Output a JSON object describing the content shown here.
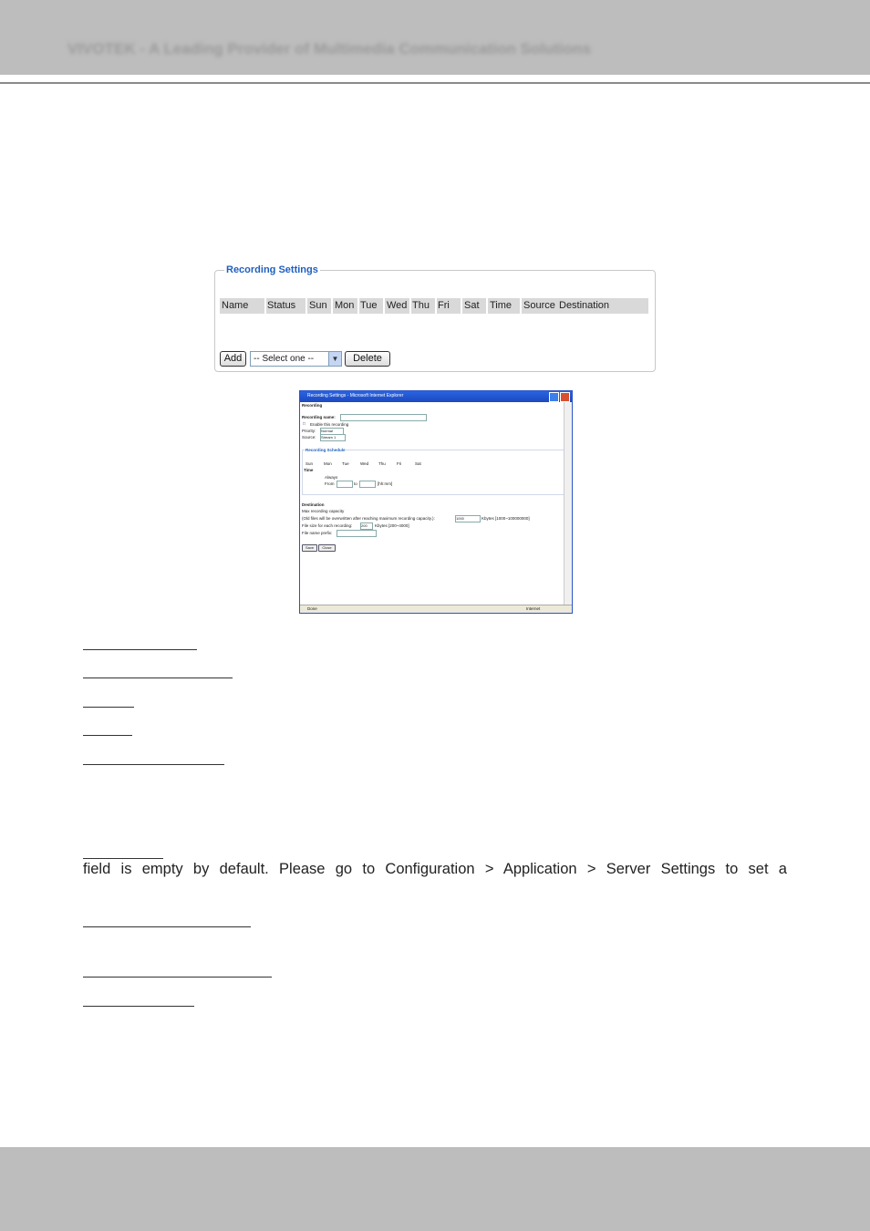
{
  "header": {
    "title": "VIVOTEK - A Leading Provider of Multimedia Communication Solutions"
  },
  "recording_settings": {
    "legend": "Recording Settings",
    "columns": [
      "Name",
      "Status",
      "Sun",
      "Mon",
      "Tue",
      "Wed",
      "Thu",
      "Fri",
      "Sat",
      "Time",
      "Source",
      "Destination"
    ],
    "add_label": "Add",
    "select_value": "-- Select one --",
    "delete_label": "Delete"
  },
  "dialog_screenshot": {
    "window_title": "Recording Settings - Microsoft Internet Explorer",
    "tab": "Recording",
    "recording_name_label": "Recording name:",
    "enable_label": "Enable this recording",
    "priority_label": "Priority:",
    "priority_value": "Normal",
    "source_label": "Source:",
    "source_value": "Stream 1",
    "schedule_title": "Recording Schedule",
    "days": [
      "Sun",
      "Mon",
      "Tue",
      "Wed",
      "Thu",
      "Fri",
      "Sat"
    ],
    "time_label": "Time",
    "always_label": "Always",
    "from_label": "From",
    "to_label": "to",
    "hhmm": "[hh:mm]",
    "destination_label": "Destination",
    "max_capacity_label": "Max recording capacity",
    "overwrite_label": "(Old files will be overwritten after reaching maximum recording capacity.):",
    "overwrite_value": "1000",
    "overwrite_range": "Kbytes [1000~100000000]",
    "file_size_label": "File size for each recording:",
    "file_size_value": "200",
    "file_size_range": "Kbytes [200~4000]",
    "prefix_label": "File name prefix:",
    "save_label": "Save",
    "close_label": "Close",
    "status_left": "Done",
    "status_right": "Internet"
  },
  "body": {
    "sentence": "field is empty by default. Please go to Configuration > Application > Server Settings to set a"
  }
}
